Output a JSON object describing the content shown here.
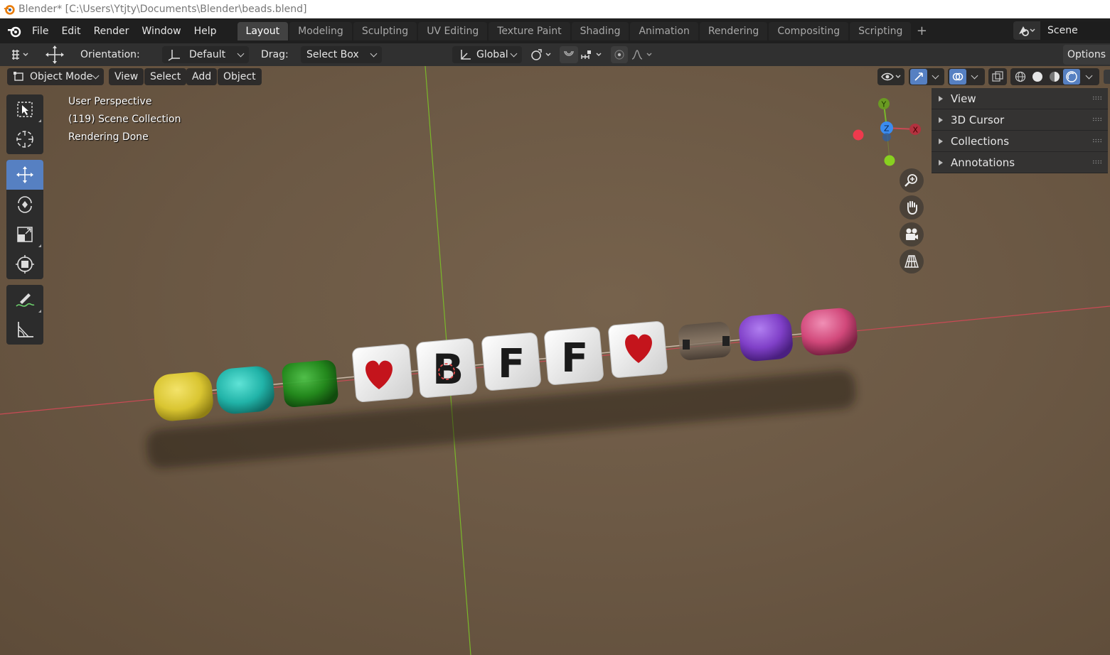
{
  "window": {
    "title": "Blender* [C:\\Users\\Ytjty\\Documents\\Blender\\beads.blend]"
  },
  "menu": {
    "items": [
      "File",
      "Edit",
      "Render",
      "Window",
      "Help"
    ]
  },
  "workspaces": {
    "tabs": [
      "Layout",
      "Modeling",
      "Sculpting",
      "UV Editing",
      "Texture Paint",
      "Shading",
      "Animation",
      "Rendering",
      "Compositing",
      "Scripting"
    ],
    "active": "Layout",
    "add_label": "+"
  },
  "scene": {
    "name": "Scene"
  },
  "tool_header": {
    "orientation_label": "Orientation:",
    "orientation_value": "Default",
    "drag_label": "Drag:",
    "drag_value": "Select Box",
    "transform_orientation": "Global",
    "options_label": "Options"
  },
  "viewport_header": {
    "mode": "Object Mode",
    "menus": [
      "View",
      "Select",
      "Add",
      "Object"
    ]
  },
  "overlay": {
    "perspective": "User Perspective",
    "collection": "(119) Scene Collection",
    "status": "Rendering Done"
  },
  "gizmo": {
    "x": "X",
    "y": "Y",
    "z": "Z"
  },
  "sidebar": {
    "panels": [
      "View",
      "3D Cursor",
      "Collections",
      "Annotations"
    ]
  },
  "beads": {
    "letters": [
      "B",
      "F",
      "F"
    ]
  },
  "colors": {
    "accent": "#5680c2",
    "x_axis": "#e8455a",
    "y_axis": "#7ab82a",
    "z_axis": "#3b8cf0",
    "bead_yellow": "#d9c531",
    "bead_teal": "#21b3a8",
    "bead_green": "#1f8a1a",
    "bead_purple": "#8040c8",
    "bead_pink": "#d1487a",
    "heart_red": "#c4141c"
  }
}
